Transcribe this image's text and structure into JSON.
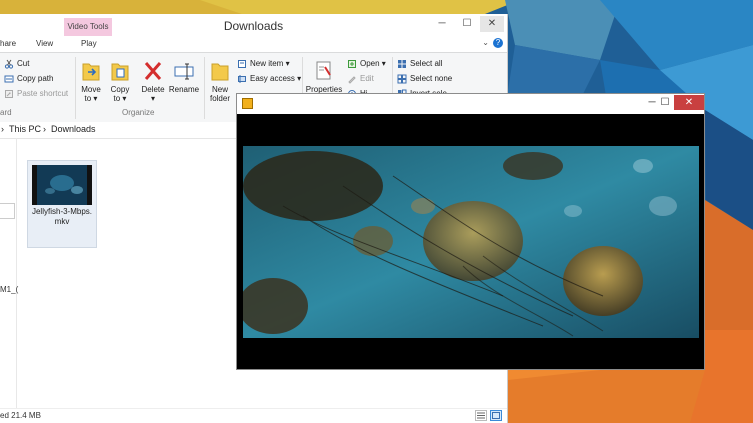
{
  "explorer": {
    "title": "Downloads",
    "contextual_tab": "Video Tools",
    "tabs": {
      "share": "hare",
      "view": "View",
      "play": "Play"
    },
    "window_controls": {
      "minimize": "─",
      "maximize": "☐",
      "close": "✕"
    },
    "help": "?",
    "ribbon": {
      "clipboard": {
        "cut": "Cut",
        "copy_path": "Copy path",
        "paste_shortcut": "Paste shortcut",
        "label": "ard"
      },
      "organize": {
        "move_to": "Move",
        "move_to_2": "to ▾",
        "copy_to": "Copy",
        "copy_to_2": "to ▾",
        "delete": "Delete",
        "delete_2": "▾",
        "rename": "Rename",
        "label": "Organize"
      },
      "new": {
        "new_folder": "New",
        "new_folder_2": "folder",
        "new_item": "New item ▾",
        "easy_access": "Easy access ▾"
      },
      "open": {
        "properties": "Properties",
        "open": "Open ▾",
        "edit": "Edit",
        "history": "Hi"
      },
      "select": {
        "select_all": "Select all",
        "select_none": "Select none",
        "invert": "Invert sele"
      }
    },
    "address": {
      "this_pc": "This PC",
      "sep": "›",
      "downloads": "Downloads",
      "lead": "›"
    },
    "nav_fragment": "M1_(",
    "file": {
      "name_line1": "Jellyfish-3-Mbps.",
      "name_line2": "mkv"
    },
    "status": "ed  21.4 MB",
    "colors": {
      "context_tab": "#f4c8df",
      "accent": "#1b73d2"
    }
  },
  "player": {
    "window_controls": {
      "minimize": "─",
      "maximize": "☐",
      "close": "✕"
    },
    "colors": {
      "close": "#c94040",
      "icon": "#f2b01c"
    }
  }
}
